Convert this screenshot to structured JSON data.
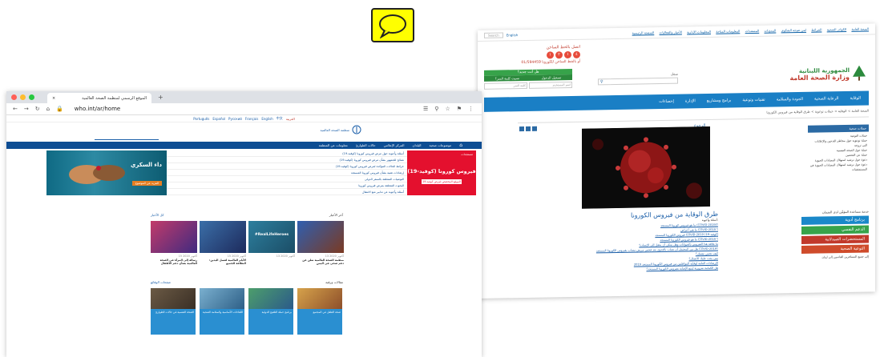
{
  "speech_bubble": {
    "icon": "speech-bubble-icon",
    "fill": "#ffff00"
  },
  "moph": {
    "topbar": {
      "links": [
        "الصفحة الرئيسية",
        "الأخبار والفعاليات",
        "المعلومات الإدارية",
        "المعلومات المتاحة",
        "المستندات",
        "المدونات",
        "لمن تتوجه الشكوى",
        "الخرائط",
        "الكوادر الصحية",
        "الصحة العامة"
      ],
      "search_placeholder": "Search",
      "lang": "English"
    },
    "hotline": {
      "call_label": "اتصل بالخط الساخن",
      "numbers": "1214",
      "sub": "أو بالخط الساخن للكورونا 01/594459"
    },
    "ministry_name": "الجمهورية اللبنانية",
    "ministry_sub": "وزارة الصحة العامة",
    "login": {
      "header": "هل أنت جديد؟",
      "register": "سجل",
      "fields": [
        "اسم المستخدم",
        "كلمة السر"
      ],
      "links": [
        "تسجيل الدخول",
        "نسيت كلمة السر؟"
      ]
    },
    "nav": [
      "الوقاية",
      "الرعاية الصحية",
      "الجودة والسلامة",
      "تقنيات وتوعية",
      "برامج ومشاريع",
      "الإدارة",
      "إحصاءات"
    ],
    "breadcrumb": "الصحة العامة > الوقاية > حملات توعوية > طرق الوقاية من فيروس الكورونا",
    "back_label": "الرجوع",
    "article_title": "طرق الوقاية من فيروس الكورونا",
    "article_intro": "أسئلة وأجوبة:",
    "bullets": [
      "ما هو فيروس كورونا المستجد (COVID-2019)؟",
      "ما هي أعراض COVID-2019 ؟",
      "فيروس الكورونا المستجد COVID-2019 (كوفيد-19)",
      "ما هو فيروس الكورونا المستجد COVID-2019 ؟",
      "ما علاقة هذا الفيروس بالحيوانات وهل يمكن أن ينتقل إلى الإنسان؟",
      "هل من المحتمل أن تصاب بالعدوى بعد فحص مريض مصاب بفيروس الكورونا المستجد COVID-2019؟",
      "كيف تحمي نفسك؟",
      "متى يجب عليك الاتصال؟",
      "الإرشادات العامة لوقاية المواطنين من فيروس الكورونا المستجد 2019",
      "هل الكمامة ضرورية لمنع الإصابة بفيروس الكورونا المستجد؟"
    ],
    "sidebar_header": "حملات صحية",
    "sidebar_items": [
      "حملات التوعية",
      "حملة توعوية حول مخاطر التدخين والإعلانات التي تروجه",
      "حملة حول الصحة النفسية",
      "حملة عن التحصين",
      "دعوة حول ترشيد استهلاك المضادات الحيوية",
      "دعوة حول ترشيد استهلاك المضادات الحيوية في المستشفيات"
    ],
    "side_heading": "خدمة مساعدة المؤمَّن لدى الضمان",
    "colorbars": [
      {
        "label": "برنامج أدوية",
        "color": "#1a88c9"
      },
      {
        "label": "الدعم النفسي",
        "color": "#37a34a"
      },
      {
        "label": "المستحضرات الصيدلانية",
        "color": "#c1392b"
      },
      {
        "label": "التوعية الصحية",
        "color": "#cf4b2b"
      }
    ],
    "side_footer": "إلى جميع المسافرين القادمين إلى لبنان"
  },
  "who": {
    "tab_title": "الموقع الرسمي لمنظمة الصحة العالمية",
    "url": "who.int/ar/home",
    "languages": [
      "Português",
      "Español",
      "Русский",
      "Français",
      "English",
      "中文",
      "العربية"
    ],
    "org_name": "منظمة الصحة العالمية",
    "nav": [
      "الصفحة الرئيسية",
      "موضوعات صحية",
      "البلدان",
      "المركز الإعلامي",
      "حالات الطوارئ",
      "معلومات عن المنظمة"
    ],
    "hero_caption": "داء السكري",
    "hero_btn": "المزيد عن الموضوع",
    "hero_list": [
      "أسئلة وأجوبة حول مرض فيروس كورونا (كوفيد-19)",
      "نصائح للجمهور بشأن مرض فيروس كورونا (كوفيد-19)",
      "خرائط الحالات المؤكدة لمرض فيروس كورونا (كوفيد-19)",
      "إرشادات تقنية بشأن فيروس كورونا المستجد",
      "التوصيات المتعلقة بالسفر الدولي",
      "البحوث المتعلقة بمرض فيروس كورونا",
      "أسئلة وأجوبة عن تدابير منع الانتقال"
    ],
    "hero_red_small": "مستجدات",
    "hero_red_title": "فيروس كورونا (كوفيد-19)",
    "hero_red_button": "الموقع المخصص لمرض كوفيد-19",
    "news_heading": "آخر الأخبار",
    "news_more": "كل الأخبار",
    "news": [
      {
        "date": "15 أكتوبر 2020",
        "text": "رسالة إلى المرأة في الصحة العالمية بشأن دعم الأطفال"
      },
      {
        "date": "15 أكتوبر 2020",
        "text": "الأيام العالمية لغسل اليدين: النظافة للجميع"
      },
      {
        "date": "13 أكتوبر 2020",
        "text": "#RealLifeHeroes"
      },
      {
        "date": "13 أكتوبر 2020",
        "text": "منظمة الصحة العالمية تعلن عن دعم صحي في اليمن"
      }
    ],
    "features_heading": "مقالات ورقية",
    "features_more": "صفحات الوقائع",
    "features": [
      {
        "text": "الصحة النفسية في حالات الطوارئ"
      },
      {
        "text": "اللقاحات الأساسية والسلامة الصحية"
      },
      {
        "text": "برنامج حملة التلقيح الدولية"
      },
      {
        "text": "صحة الطفل في المجتمع"
      }
    ]
  }
}
